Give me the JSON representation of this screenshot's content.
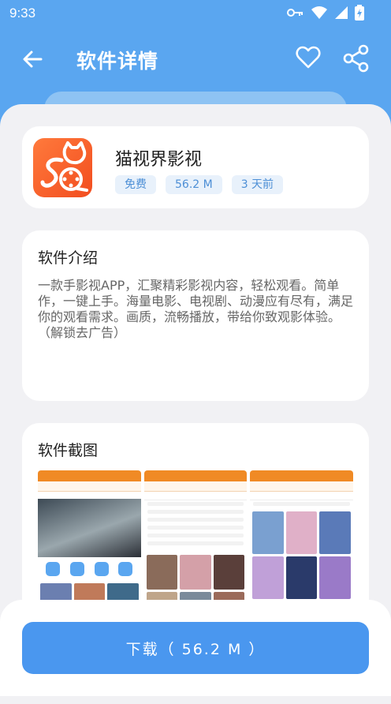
{
  "status": {
    "time": "9:33"
  },
  "header": {
    "title": "软件详情"
  },
  "app": {
    "name": "猫视界影视",
    "tags": [
      "免费",
      "56.2 M",
      "3 天前"
    ]
  },
  "intro": {
    "heading": "软件介绍",
    "text": "一款手影视APP，汇聚精彩影视内容，轻松观看。简单作，一键上手。海量电影、电视剧、动漫应有尽有，满足你的观看需求。画质，流畅播放，带给你致观影体验。（解锁去广告）"
  },
  "screenshots": {
    "heading": "软件截图"
  },
  "download": {
    "label": "下载（ 56.2 M ）"
  },
  "colors": {
    "primary": "#5aa6f0",
    "button": "#4a97ef",
    "tag_bg": "#e8f1fb",
    "tag_text": "#4d8fd6",
    "app_icon": "#f24d1f"
  }
}
